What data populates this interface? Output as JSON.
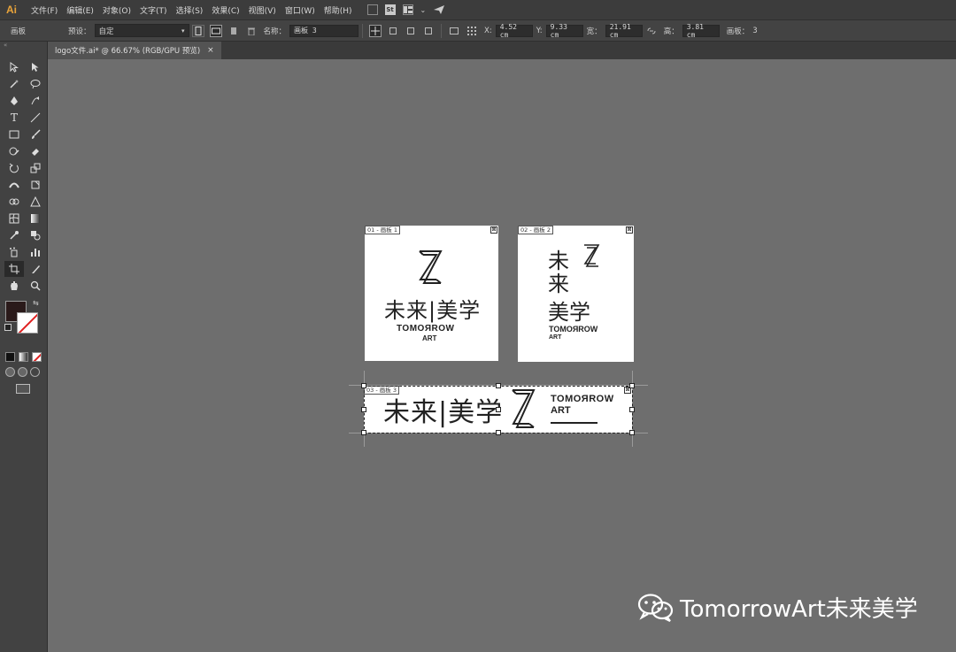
{
  "app": {
    "logo": "Ai"
  },
  "menu": [
    "文件(F)",
    "编辑(E)",
    "对象(O)",
    "文字(T)",
    "选择(S)",
    "效果(C)",
    "视图(V)",
    "窗口(W)",
    "帮助(H)"
  ],
  "menubar_icons": {
    "st_label": "St",
    "dropdown_glyph": "⌄"
  },
  "control": {
    "panel_label": "画板",
    "preset_label": "预设：",
    "preset_value": "自定",
    "name_label": "名称：",
    "name_value": "画板 3",
    "x_label": "X:",
    "x_value": "4.52 cm",
    "y_label": "Y:",
    "y_value": "9.33 cm",
    "w_label": "宽：",
    "w_value": "21.91 cm",
    "h_label": "高：",
    "h_value": "3.81 cm",
    "artboards_label": "画板：",
    "artboards_value": "3"
  },
  "tab": {
    "title": "logo文件.ai* @ 66.67% (RGB/GPU 预览)",
    "close": "×"
  },
  "toolbox": {
    "grip": "«"
  },
  "artboards": [
    {
      "label": "01 - 画板 1",
      "close": "⊠",
      "cn_text": "未来|美学",
      "en_line1": "TOMOЯROW",
      "en_line2": "ART"
    },
    {
      "label": "02 - 画板 2",
      "close": "⊠",
      "cn_line1": "未",
      "cn_line2": "来",
      "cn_line3": "美学",
      "en_line1": "TOMOЯROW",
      "en_line2": "ART"
    },
    {
      "label": "03 - 画板 3",
      "close": "⊠",
      "cn_text": "未来|美学",
      "en_line1": "TOMOЯROW",
      "en_line2": "ART"
    }
  ],
  "watermark": {
    "text": "TomorrowArt未来美学",
    "icon": "wechat-icon"
  }
}
